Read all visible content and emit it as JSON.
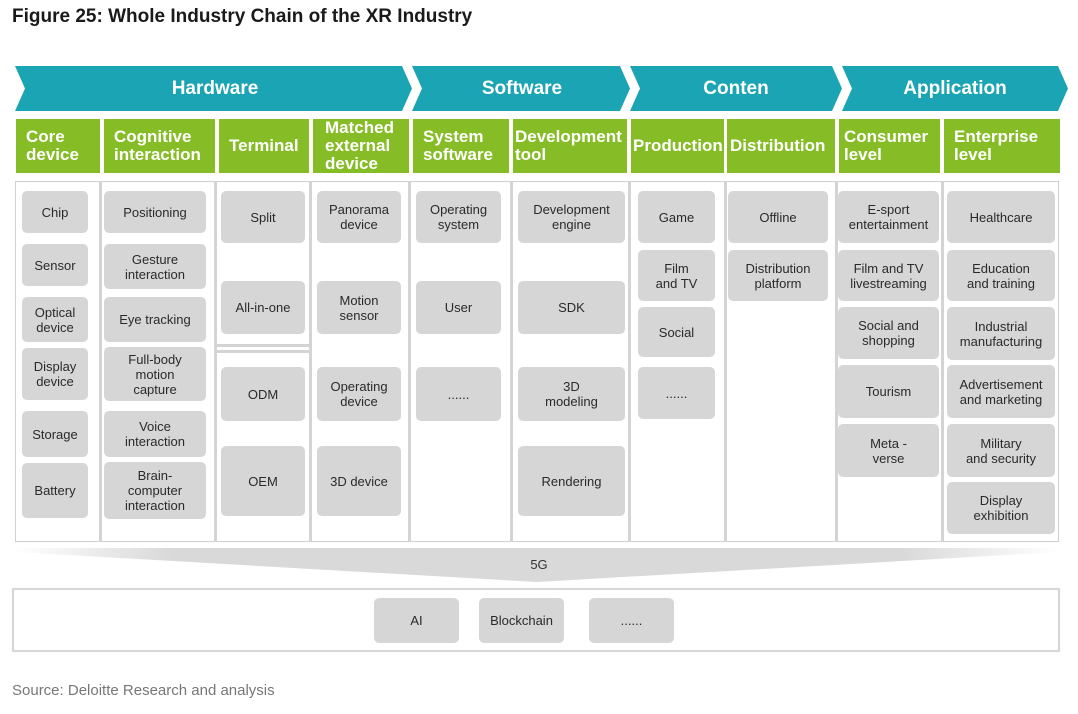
{
  "title": "Figure 25: Whole Industry Chain of the XR Industry",
  "source": "Source: Deloitte Research and analysis",
  "colors": {
    "teal": "#1ba4b4",
    "green": "#86bc25",
    "box": "#d6d6d6"
  },
  "stages": [
    "Hardware",
    "Software",
    "Conten",
    "Application"
  ],
  "groups": {
    "core": "Core\ndevice",
    "cognitive": "Cognitive\ninteraction",
    "terminal": "Terminal",
    "matched": "Matched\nexternal\ndevice",
    "system": "System\nsoftware",
    "devtool": "Development\ntool",
    "production": "Production",
    "distribution": "Distribution",
    "consumer": "Consumer\nlevel",
    "enterprise": "Enterprise\nlevel"
  },
  "items": {
    "core": [
      "Chip",
      "Sensor",
      "Optical\ndevice",
      "Display\ndevice",
      "Storage",
      "Battery"
    ],
    "cognitive": [
      "Positioning",
      "Gesture\ninteraction",
      "Eye tracking",
      "Full-body\nmotion\ncapture",
      "Voice\ninteraction",
      "Brain-\ncomputer\ninteraction"
    ],
    "terminal": [
      "Split",
      "All-in-one",
      "ODM",
      "OEM"
    ],
    "matched": [
      "Panorama\ndevice",
      "Motion\nsensor",
      "Operating\ndevice",
      "3D device"
    ],
    "system": [
      "Operating\nsystem",
      "User",
      "......"
    ],
    "devtool": [
      "Development\nengine",
      "SDK",
      "3D\nmodeling",
      "Rendering"
    ],
    "production": [
      "Game",
      "Film\nand TV",
      "Social",
      "......"
    ],
    "distribution": [
      "Offline",
      "Distribution\nplatform"
    ],
    "consumer": [
      "E-sport\nentertainment",
      "Film and TV\nlivestreaming",
      "Social and\nshopping",
      "Tourism",
      "Meta -\nverse"
    ],
    "enterprise": [
      "Healthcare",
      "Education\nand training",
      "Industrial\nmanufacturing",
      "Advertisement\nand marketing",
      "Military\nand security",
      "Display\nexhibition"
    ]
  },
  "band_label": "5G",
  "foundation": [
    "AI",
    "Blockchain",
    "......"
  ]
}
